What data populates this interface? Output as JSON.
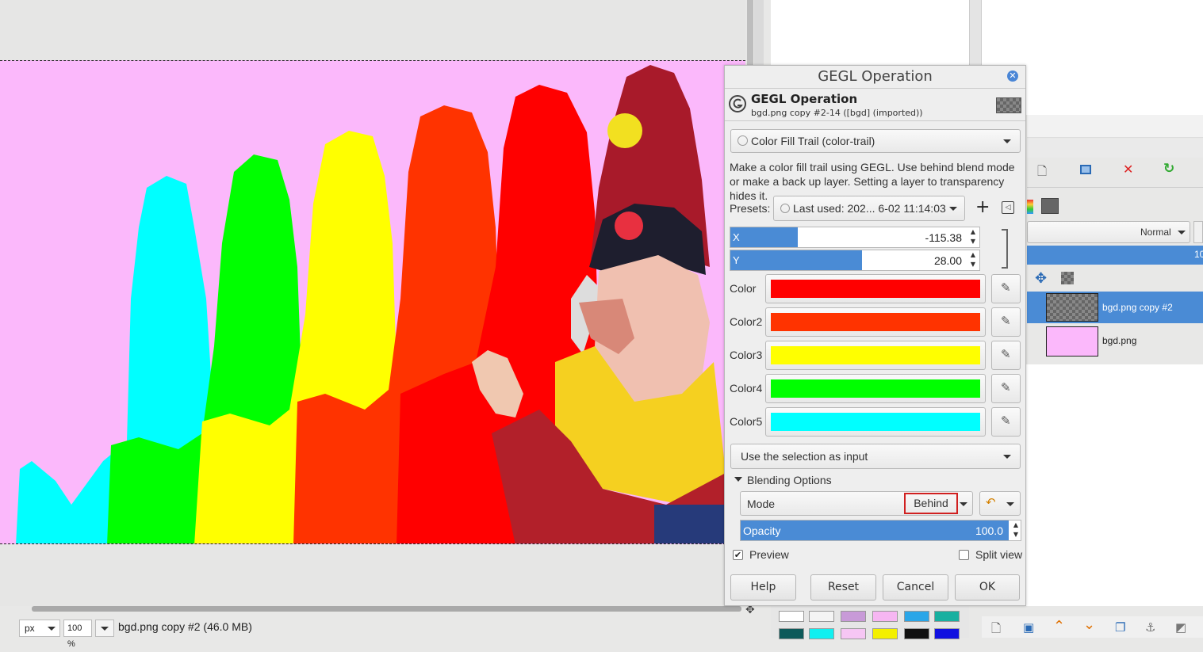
{
  "statusbar": {
    "unit": "px",
    "zoom": "100 %",
    "image_info": "bgd.png copy #2 (46.0 MB)"
  },
  "dialog": {
    "window_title": "GEGL Operation",
    "header_title": "GEGL Operation",
    "header_subtitle": "bgd.png copy #2-14 ([bgd] (imported))",
    "operation": "Color Fill Trail (color-trail)",
    "description": "Make a color fill trail using GEGL. Use behind blend mode or make a back up layer. Setting a layer to transparency hides it.",
    "presets_label": "Presets:",
    "presets_value": "Last used: 202... 6-02 11:14:03",
    "x_label": "X",
    "x_value": "-115.38",
    "x_fill": 0.27,
    "y_label": "Y",
    "y_value": "28.00",
    "y_fill": 0.53,
    "colors": [
      {
        "label": "Color",
        "hex": "#ff0000"
      },
      {
        "label": "Color2",
        "hex": "#ff3300"
      },
      {
        "label": "Color3",
        "hex": "#ffff00"
      },
      {
        "label": "Color4",
        "hex": "#00ff00"
      },
      {
        "label": "Color5",
        "hex": "#00ffff"
      }
    ],
    "input_mode": "Use the selection as input",
    "blending_label": "Blending Options",
    "mode_label": "Mode",
    "mode_value": "Behind",
    "opacity_label": "Opacity",
    "opacity_value": "100.0",
    "opacity_fill": 1.0,
    "preview_label": "Preview",
    "preview_checked": true,
    "split_label": "Split view",
    "split_checked": false,
    "buttons": {
      "help": "Help",
      "reset": "Reset",
      "cancel": "Cancel",
      "ok": "OK"
    }
  },
  "layers": {
    "mode": "Normal",
    "opacity_value_partial": "10",
    "items": [
      {
        "name": "bgd.png copy #2",
        "selected": true
      },
      {
        "name": "bgd.png",
        "selected": false
      }
    ]
  },
  "colors_theme": {
    "accent": "#4a8bd5",
    "canvas_bg": "#fbb8fb"
  }
}
